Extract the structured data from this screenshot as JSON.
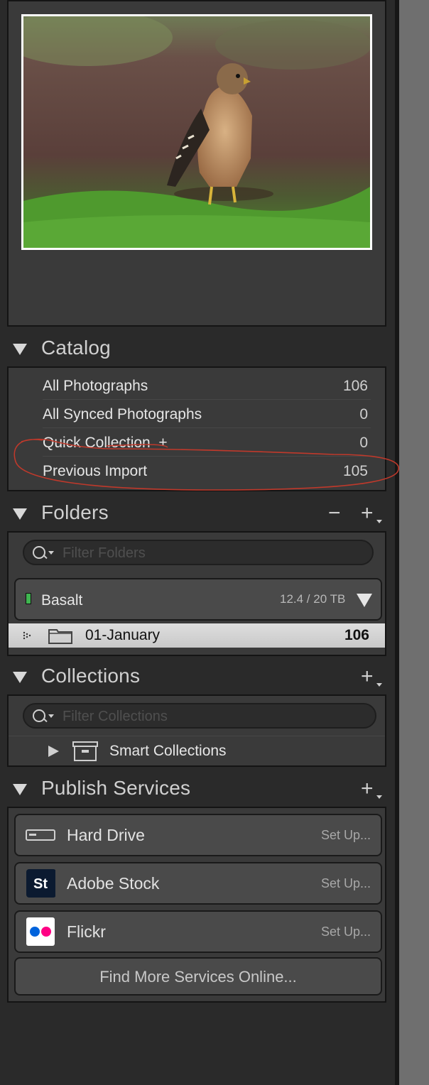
{
  "catalog": {
    "title": "Catalog",
    "items": [
      {
        "label": "All Photographs",
        "count": "106"
      },
      {
        "label": "All Synced Photographs",
        "count": "0"
      },
      {
        "label": "Quick Collection  +",
        "count": "0"
      },
      {
        "label": "Previous Import",
        "count": "105"
      }
    ]
  },
  "folders": {
    "title": "Folders",
    "remove_label": "−",
    "add_label": "+",
    "filter_placeholder": "Filter Folders",
    "volume": {
      "name": "Basalt",
      "size": "12.4 / 20 TB"
    },
    "items": [
      {
        "label": "01-January",
        "count": "106"
      }
    ]
  },
  "collections": {
    "title": "Collections",
    "add_label": "+",
    "filter_placeholder": "Filter Collections",
    "items": [
      {
        "label": "Smart Collections"
      }
    ]
  },
  "publish": {
    "title": "Publish Services",
    "add_label": "+",
    "services": [
      {
        "name": "Hard Drive",
        "action": "Set Up...",
        "icon": "hard-drive-icon"
      },
      {
        "name": "Adobe Stock",
        "action": "Set Up...",
        "icon": "adobe-stock-icon",
        "icon_text": "St"
      },
      {
        "name": "Flickr",
        "action": "Set Up...",
        "icon": "flickr-icon"
      }
    ],
    "find_more": "Find More Services Online..."
  },
  "colors": {
    "panel_bg": "#2a2a2a",
    "box_bg": "#3a3a3a",
    "selected_row": "#d6d6d6",
    "volume_led": "#3fb550",
    "annotation_ink": "#c0392b",
    "flickr_blue": "#0063dc",
    "flickr_pink": "#ff0084",
    "stock_bg": "#0b1a30"
  }
}
